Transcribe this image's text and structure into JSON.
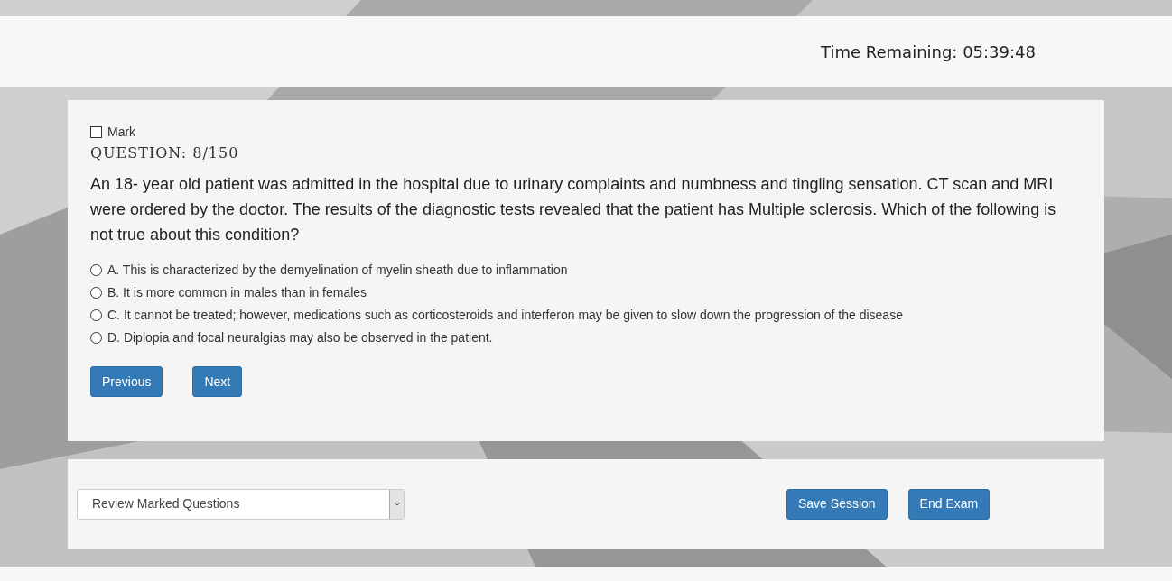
{
  "timer": {
    "label": "Time Remaining: 05:39:48"
  },
  "question": {
    "mark": {
      "label": "Mark",
      "checked": false
    },
    "heading": "QUESTION: 8/150",
    "text": "An 18- year old patient was admitted in the hospital due to urinary complaints and numbness and tingling sensation. CT scan and MRI were ordered by the doctor. The results of the diagnostic tests revealed that the patient has Multiple sclerosis. Which of the following is not true about this condition?",
    "options": [
      {
        "label": "A. This is characterized by the demyelination of myelin sheath due to inflammation",
        "selected": false
      },
      {
        "label": "B. It is more common in males than in females",
        "selected": false
      },
      {
        "label": "C. It cannot be treated; however, medications such as corticosteroids and interferon may be given to slow down the progression of the disease",
        "selected": false
      },
      {
        "label": "D. Diplopia and focal neuralgias may also be observed in the patient.",
        "selected": false
      }
    ],
    "buttons": [
      "Previous",
      "Next"
    ]
  },
  "footer": {
    "review_select": {
      "value": "Review Marked Questions"
    },
    "buttons": [
      "Save Session",
      "End Exam"
    ]
  }
}
